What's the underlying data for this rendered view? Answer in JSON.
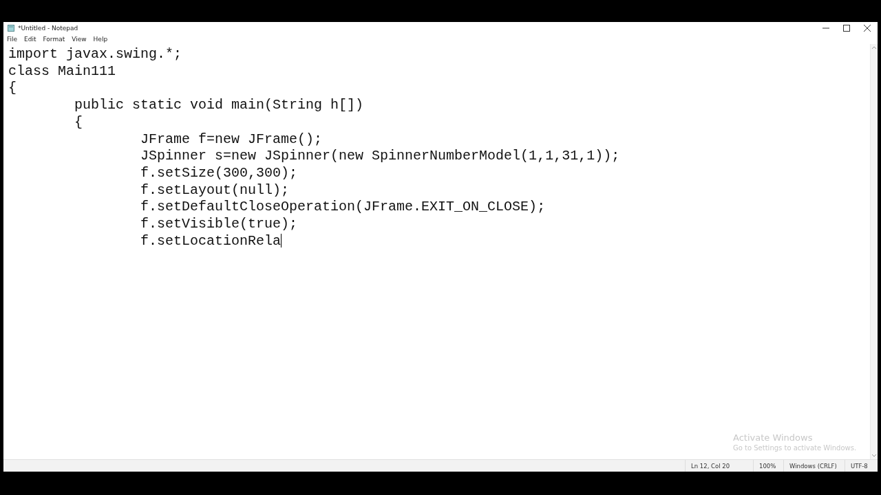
{
  "window": {
    "title": "*Untitled - Notepad"
  },
  "menu": [
    "File",
    "Edit",
    "Format",
    "View",
    "Help"
  ],
  "editor": {
    "lines": [
      "import javax.swing.*;",
      "class Main111",
      "{",
      "\tpublic static void main(String h[])",
      "\t{",
      "\t\tJFrame f=new JFrame();",
      "\t\tJSpinner s=new JSpinner(new SpinnerNumberModel(1,1,31,1));",
      "\t\tf.setSize(300,300);",
      "\t\tf.setLayout(null);",
      "\t\tf.setDefaultCloseOperation(JFrame.EXIT_ON_CLOSE);",
      "\t\tf.setVisible(true);",
      "\t\tf.setLocationRela"
    ]
  },
  "activation_notice": {
    "title": "Activate Windows",
    "message": "Go to Settings to activate Windows."
  },
  "status_bar": {
    "position": "Ln 12, Col 20",
    "zoom": "100%",
    "line_ending": "Windows (CRLF)",
    "encoding": "UTF-8"
  }
}
